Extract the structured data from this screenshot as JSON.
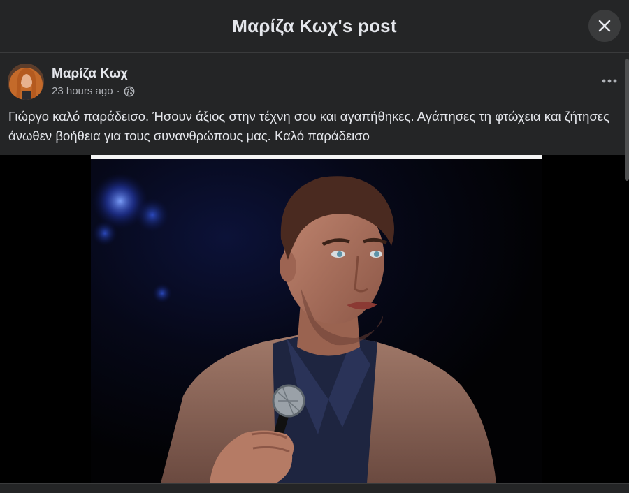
{
  "dialog": {
    "title": "Μαρίζα Κωχ's post",
    "close_icon": "close-icon"
  },
  "post": {
    "author": "Μαρίζα Κωχ",
    "timestamp": "23 hours ago",
    "separator": "·",
    "audience_icon": "globe-icon",
    "more_icon": "more-horizontal-icon",
    "text": "Γιώργο καλό παράδεισο. Ήσουν άξιος στην τέχνη σου και αγαπήθηκες. Αγάπησες τη φτώχεια και ζήτησες άνωθεν βοήθεια για τους συνανθρώπους μας. Καλό παράδεισο"
  },
  "colors": {
    "background": "#242526",
    "text_primary": "#e4e6eb",
    "text_secondary": "#b0b3b8",
    "button_bg": "#3a3b3c"
  }
}
